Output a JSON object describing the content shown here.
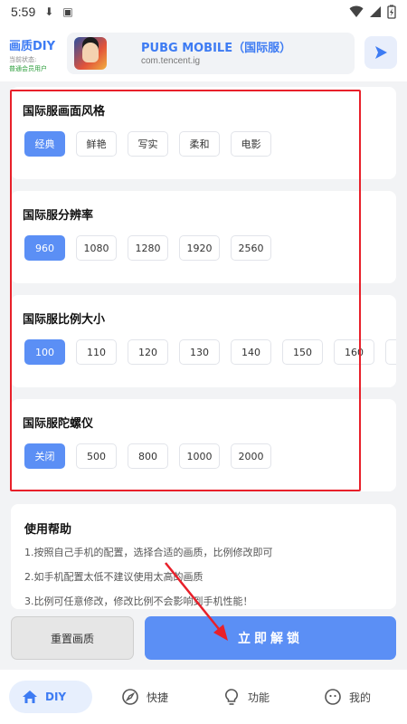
{
  "status_bar": {
    "time": "5:59"
  },
  "header": {
    "brand_title": "画质DIY",
    "brand_status": "当前状态:",
    "brand_user": "普通会员用户",
    "game_name": "PUBG MOBILE（国际服）",
    "game_package": "com.tencent.ig"
  },
  "sections": [
    {
      "title": "国际服画面风格",
      "options": [
        "经典",
        "鲜艳",
        "写实",
        "柔和",
        "电影"
      ],
      "selected": "经典"
    },
    {
      "title": "国际服分辨率",
      "options": [
        "960",
        "1080",
        "1280",
        "1920",
        "2560"
      ],
      "selected": "960"
    },
    {
      "title": "国际服比例大小",
      "options": [
        "100",
        "110",
        "120",
        "130",
        "140",
        "150",
        "160"
      ],
      "selected": "100"
    },
    {
      "title": "国际服陀螺仪",
      "options": [
        "关闭",
        "500",
        "800",
        "1000",
        "2000"
      ],
      "selected": "关闭"
    }
  ],
  "help": {
    "title": "使用帮助",
    "lines": [
      "1.按照自己手机的配置，选择合适的画质，比例修改即可",
      "2.如手机配置太低不建议使用太高的画质",
      "3.比例可任意修改，修改比例不会影响到手机性能！"
    ]
  },
  "actions": {
    "reset_label": "重置画质",
    "unlock_label": "立即解锁"
  },
  "bottom_nav": [
    {
      "label": "DIY",
      "icon": "home-icon",
      "active": true
    },
    {
      "label": "快捷",
      "icon": "compass-icon",
      "active": false
    },
    {
      "label": "功能",
      "icon": "lightbulb-icon",
      "active": false
    },
    {
      "label": "我的",
      "icon": "face-icon",
      "active": false
    }
  ],
  "colors": {
    "accent": "#5b8ff5",
    "brand_blue": "#3d7bf3",
    "highlight_frame": "#e8202a"
  }
}
